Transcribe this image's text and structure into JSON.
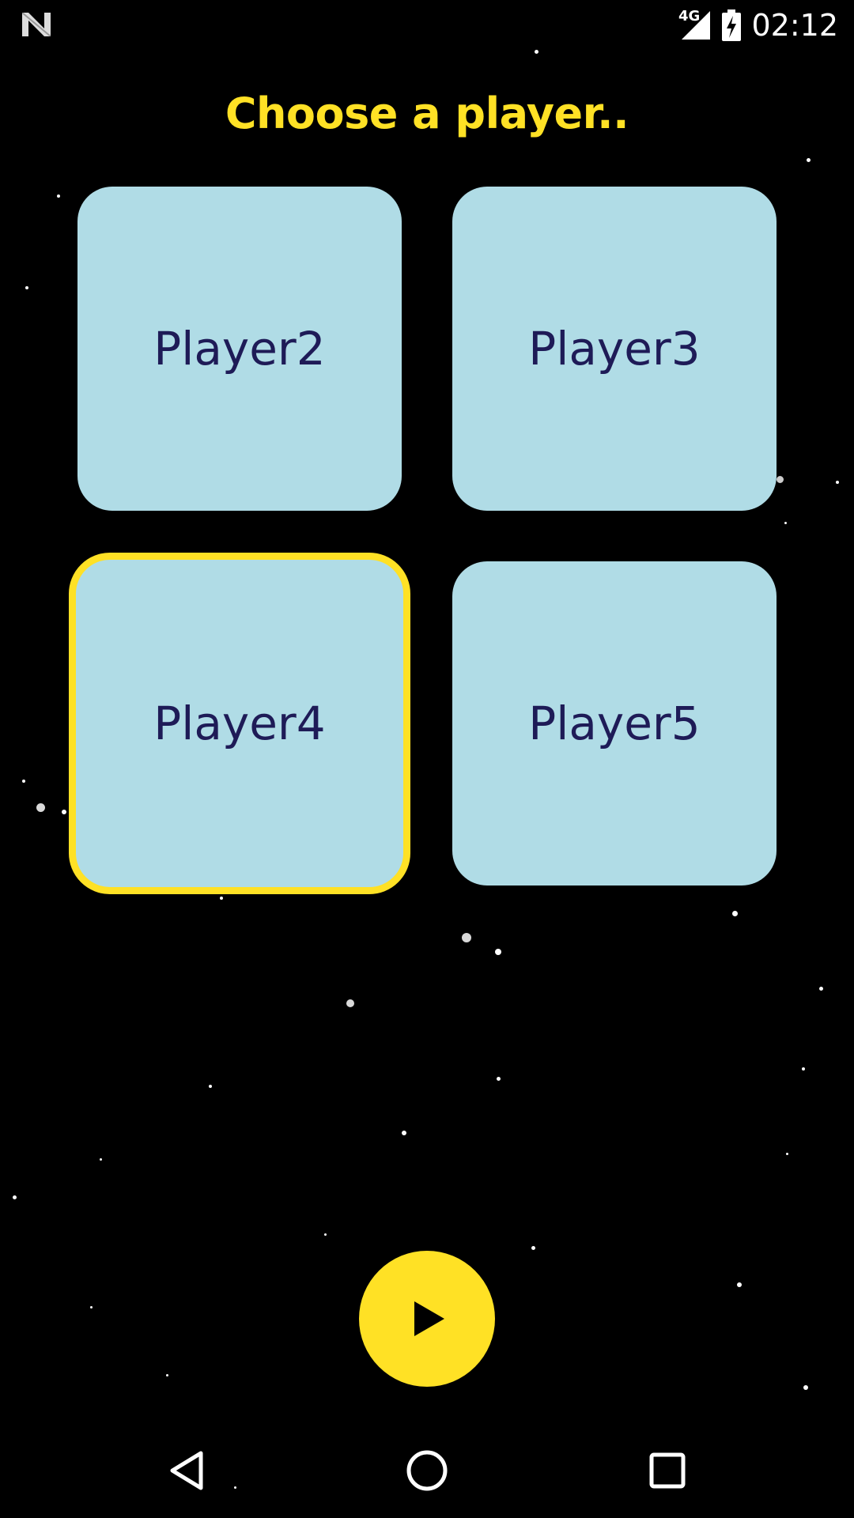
{
  "status_bar": {
    "network": "4G",
    "time": "02:12",
    "icons": [
      "notification-n-icon",
      "signal-icon",
      "battery-charging-icon"
    ]
  },
  "title": "Choose a player..",
  "players": [
    {
      "label": "Player2",
      "selected": false
    },
    {
      "label": "Player3",
      "selected": false
    },
    {
      "label": "Player4",
      "selected": true
    },
    {
      "label": "Player5",
      "selected": false
    }
  ],
  "play_button": {
    "icon": "play-icon"
  },
  "nav_bar": {
    "icons": [
      "back-icon",
      "home-icon",
      "recents-icon"
    ]
  },
  "colors": {
    "background": "#000000",
    "accent": "#FFE125",
    "tile": "#B0DCE6",
    "tile_text": "#1E1B57"
  }
}
